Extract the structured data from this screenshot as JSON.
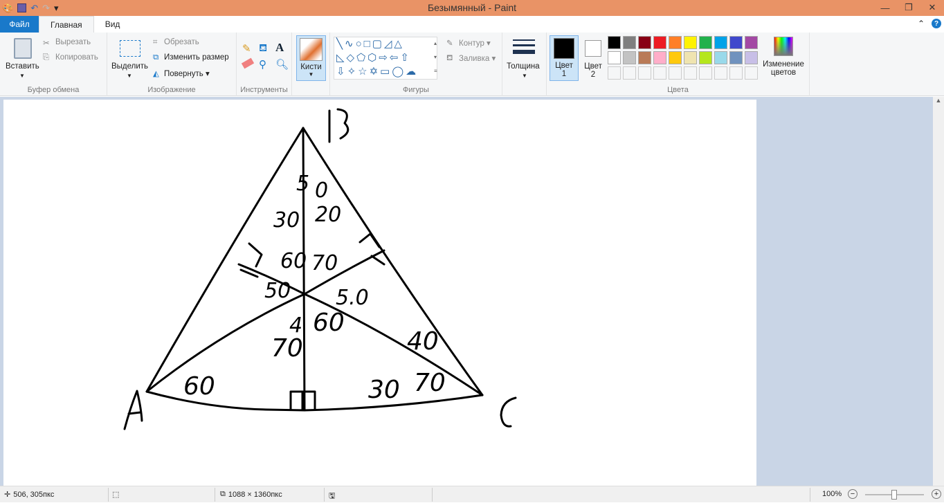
{
  "window": {
    "title": "Безымянный - Paint"
  },
  "tabs": [
    {
      "label": "Файл"
    },
    {
      "label": "Главная"
    },
    {
      "label": "Вид"
    }
  ],
  "clipboard": {
    "paste": "Вставить",
    "cut": "Вырезать",
    "copy": "Копировать",
    "group": "Буфер обмена"
  },
  "image": {
    "select": "Выделить",
    "crop": "Обрезать",
    "resize": "Изменить размер",
    "rotate": "Повернуть",
    "group": "Изображение"
  },
  "tools": {
    "group": "Инструменты"
  },
  "brushes": {
    "label": "Кисти"
  },
  "shapes": {
    "outline": "Контур",
    "fill": "Заливка",
    "group": "Фигуры"
  },
  "size": {
    "label": "Толщина"
  },
  "colors": {
    "color1": "Цвет",
    "color1_num": "1",
    "color2": "Цвет",
    "color2_num": "2",
    "edit1": "Изменение",
    "edit2": "цветов",
    "group": "Цвета",
    "color1_value": "#000000",
    "color2_value": "#ffffff",
    "palette_row1": [
      "#000000",
      "#7f7f7f",
      "#880015",
      "#ed1c24",
      "#ff7f27",
      "#fff200",
      "#22b14c",
      "#00a2e8",
      "#3f48cc",
      "#a349a4"
    ],
    "palette_row2": [
      "#ffffff",
      "#c3c3c3",
      "#b97a57",
      "#ffaec9",
      "#ffc90e",
      "#efe4b0",
      "#b5e61d",
      "#99d9ea",
      "#7092be",
      "#c8bfe7"
    ]
  },
  "drawing": {
    "labels": [
      {
        "text": "B"
      },
      {
        "text": "A"
      },
      {
        "text": "C"
      },
      {
        "text": "5"
      },
      {
        "text": "0"
      },
      {
        "text": "30"
      },
      {
        "text": "20"
      },
      {
        "text": "60"
      },
      {
        "text": "70"
      },
      {
        "text": "50"
      },
      {
        "text": "5.0"
      },
      {
        "text": "4"
      },
      {
        "text": "60"
      },
      {
        "text": "70"
      },
      {
        "text": "40"
      },
      {
        "text": "60"
      },
      {
        "text": "30"
      },
      {
        "text": "70"
      }
    ]
  },
  "status": {
    "cursor": "506, 305пкс",
    "size": "1088 × 1360пкс",
    "zoom": "100%"
  }
}
